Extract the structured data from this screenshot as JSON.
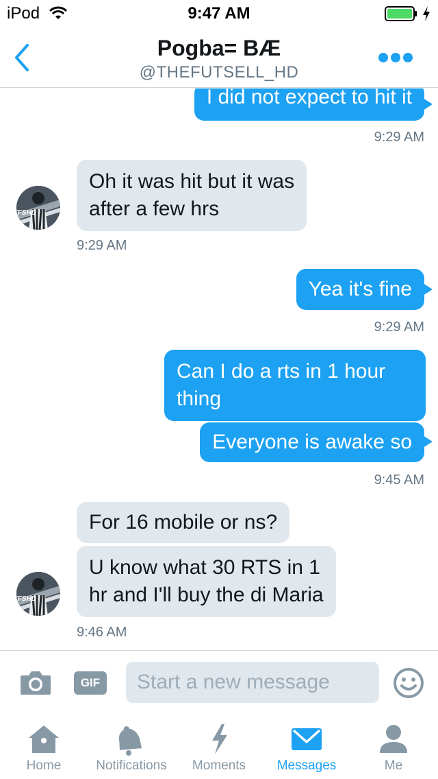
{
  "status_bar": {
    "carrier": "iPod",
    "time": "9:47 AM"
  },
  "header": {
    "name": "Pogba= BÆ",
    "handle": "@THEFUTSELL_HD"
  },
  "messages": [
    {
      "direction": "sent",
      "text": "I did not expect to hit it"
    },
    {
      "direction": "received",
      "lines": [
        "Oh it was hit but it was",
        "after a few hrs"
      ]
    },
    {
      "direction": "sent",
      "text": "Yea it's fine"
    },
    {
      "direction": "sent",
      "lines": [
        "Can I do a rts in 1 hour",
        "thing"
      ]
    },
    {
      "direction": "sent",
      "text": "Everyone is awake so"
    },
    {
      "direction": "received",
      "text": "For 16 mobile or ns?"
    },
    {
      "direction": "received",
      "lines": [
        "U know what 30 RTS in 1",
        "hr and I'll buy the di Maria"
      ]
    }
  ],
  "timestamps": [
    "9:29 AM",
    "9:29 AM",
    "9:29 AM",
    "9:45 AM",
    "9:46 AM"
  ],
  "avatar_text": "TFSHD",
  "composer": {
    "gif_label": "GIF",
    "placeholder": "Start a new message"
  },
  "tabs": [
    {
      "label": "Home",
      "icon": "home-icon",
      "active": false
    },
    {
      "label": "Notifications",
      "icon": "bell-icon",
      "active": false
    },
    {
      "label": "Moments",
      "icon": "lightning-icon",
      "active": false
    },
    {
      "label": "Messages",
      "icon": "envelope-icon",
      "active": true
    },
    {
      "label": "Me",
      "icon": "person-icon",
      "active": false
    }
  ],
  "colors": {
    "accent": "#1da1f2",
    "received_bubble": "#e1e8ed",
    "secondary_text": "#657786",
    "inactive_icon": "#8899a6",
    "battery": "#4cd964"
  }
}
